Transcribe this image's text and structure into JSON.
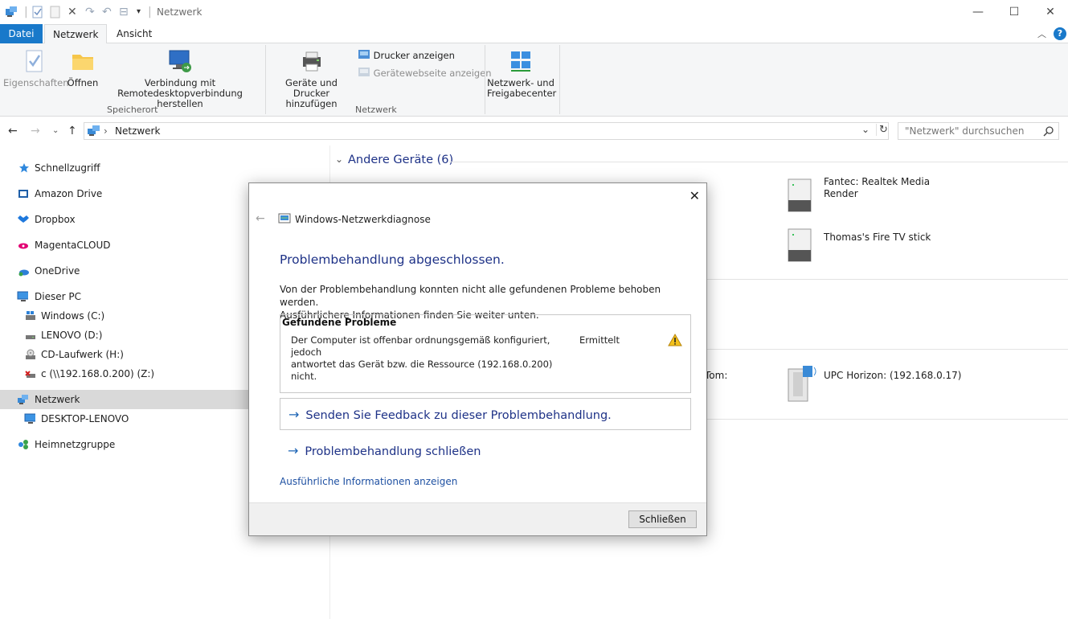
{
  "window": {
    "title": "Netzwerk",
    "minimize": "—",
    "maximize": "☐",
    "close": "✕"
  },
  "ribbon": {
    "tabs": {
      "file": "Datei",
      "network": "Netzwerk",
      "view": "Ansicht"
    },
    "buttons": {
      "properties": "Eigenschaften",
      "open": "Öffnen",
      "remote_line1": "Verbindung mit",
      "remote_line2": "Remotedesktopverbindung herstellen",
      "add_devices_line1": "Geräte und Drucker",
      "add_devices_line2": "hinzufügen",
      "show_printers": "Drucker anzeigen",
      "device_webpage": "Gerätewebseite anzeigen",
      "netcenter_line1": "Netzwerk- und",
      "netcenter_line2": "Freigabecenter"
    },
    "groups": {
      "location": "Speicherort",
      "network": "Netzwerk"
    }
  },
  "address": {
    "path": "Netzwerk",
    "search_placeholder": "\"Netzwerk\" durchsuchen"
  },
  "navpane": {
    "items": [
      {
        "label": "Schnellzugriff"
      },
      {
        "label": "Amazon Drive"
      },
      {
        "label": "Dropbox"
      },
      {
        "label": "MagentaCLOUD"
      },
      {
        "label": "OneDrive"
      },
      {
        "label": "Dieser PC"
      },
      {
        "label": "Windows (C:)"
      },
      {
        "label": "LENOVO (D:)"
      },
      {
        "label": "CD-Laufwerk (H:)"
      },
      {
        "label": "c (\\\\192.168.0.200) (Z:)"
      },
      {
        "label": "Netzwerk"
      },
      {
        "label": "DESKTOP-LENOVO"
      },
      {
        "label": "Heimnetzgruppe"
      }
    ]
  },
  "content": {
    "group_other_devices": "Andere Geräte (6)",
    "devices": {
      "fantec_line1": "Fantec: Realtek Media",
      "fantec_line2": "Render",
      "firetv": "Thomas's Fire TV stick",
      "tom_partial": "Tom:",
      "upc": "UPC Horizon: (192.168.0.17)"
    }
  },
  "dialog": {
    "title": "Windows-Netzwerkdiagnose",
    "heading": "Problembehandlung abgeschlossen.",
    "text_line1": "Von der Problembehandlung konnten nicht alle gefundenen Probleme behoben werden.",
    "text_line2": "Ausführlichere Informationen finden Sie weiter unten.",
    "problems_header": "Gefundene Probleme",
    "problem_line1": "Der Computer ist offenbar ordnungsgemäß konfiguriert, jedoch",
    "problem_line2": "antwortet das Gerät bzw. die Ressource (192.168.0.200) nicht.",
    "problem_status": "Ermittelt",
    "link_feedback": "Senden Sie Feedback zu dieser Problembehandlung.",
    "link_close": "Problembehandlung schließen",
    "link_details": "Ausführliche Informationen anzeigen",
    "close_button": "Schließen"
  },
  "colors": {
    "accent": "#1979ca",
    "link": "#1e3287",
    "selected": "#d9d9d9"
  }
}
